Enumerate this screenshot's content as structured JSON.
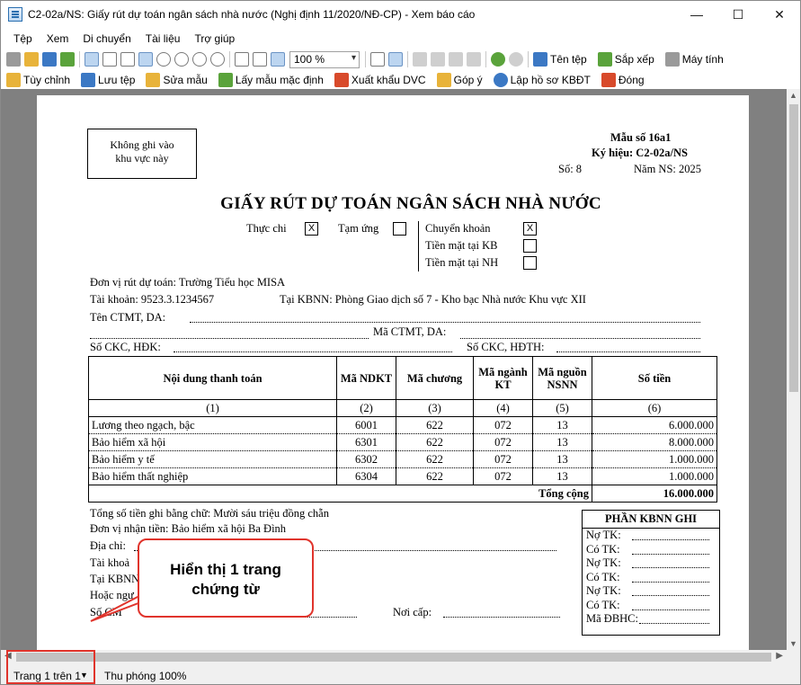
{
  "window": {
    "title": "C2-02a/NS: Giấy rút dự toán ngân sách nhà nước (Nghị định 11/2020/NĐ-CP) - Xem báo cáo",
    "minimize": "—",
    "maximize": "☐",
    "close": "✕"
  },
  "menu": [
    "Tệp",
    "Xem",
    "Di chuyển",
    "Tài liệu",
    "Trợ giúp"
  ],
  "toolbar1": {
    "zoom_value": "100 %",
    "filename_label": "Tên tệp",
    "sort_label": "Sắp xếp",
    "computer_label": "Máy tính"
  },
  "toolbar2": {
    "customize": "Tùy chỉnh",
    "save_template": "Lưu tệp",
    "edit_template": "Sửa mẫu",
    "default_template": "Lấy mẫu mặc định",
    "export_dvc": "Xuất khẩu DVC",
    "feedback": "Góp ý",
    "create_kbdt": "Lập hồ sơ KBĐT",
    "close": "Đóng"
  },
  "document": {
    "no_write_box": [
      "Không ghi vào",
      "khu vực này"
    ],
    "form_no": "Mẫu số 16a1",
    "symbol": "Ký hiệu: C2-02a/NS",
    "number": "Số: 8",
    "budget_year": "Năm NS: 2025",
    "title": "GIẤY RÚT DỰ TOÁN NGÂN SÁCH NHÀ NƯỚC",
    "options": {
      "thuc_chi": "Thực chi",
      "thuc_chi_mark": "X",
      "tam_ung": "Tạm ứng",
      "tam_ung_mark": "",
      "chuyen_khoan": "Chuyển khoản",
      "chuyen_khoan_mark": "X",
      "tien_mat_kb": "Tiền mặt tại KB",
      "tien_mat_kb_mark": "",
      "tien_mat_nh": "Tiền mặt tại NH",
      "tien_mat_nh_mark": ""
    },
    "unit": "Đơn vị rút dự toán: Trường Tiểu học MISA",
    "account": "Tài khoản: 9523.3.1234567",
    "kbnn": "Tại KBNN: Phòng Giao dịch số 7 - Kho bạc Nhà nước Khu vực XII",
    "ten_ctmt": "Tên  CTMT,  DA:",
    "ma_ctmt": "Mã  CTMT,  DA:",
    "so_ckc_hdk": "Số  CKC,  HĐK:",
    "so_ckc_hdth": "Số  CKC,  HĐTH:",
    "table": {
      "headers": [
        "Nội dung thanh toán",
        "Mã NDKT",
        "Mã chương",
        "Mã ngành KT",
        "Mã nguồn NSNN",
        "Số tiền"
      ],
      "col_numbers": [
        "(1)",
        "(2)",
        "(3)",
        "(4)",
        "(5)",
        "(6)"
      ],
      "rows": [
        [
          "Lương theo ngạch, bậc",
          "6001",
          "622",
          "072",
          "13",
          "6.000.000"
        ],
        [
          "Bảo hiểm xã hội",
          "6301",
          "622",
          "072",
          "13",
          "8.000.000"
        ],
        [
          "Bảo hiểm y tế",
          "6302",
          "622",
          "072",
          "13",
          "1.000.000"
        ],
        [
          "Bảo hiểm thất nghiệp",
          "6304",
          "622",
          "072",
          "13",
          "1.000.000"
        ]
      ],
      "total_label": "Tổng cộng",
      "total_value": "16.000.000"
    },
    "amount_words": "Tổng số tiền ghi bằng chữ: Mười sáu triệu đồng chẵn",
    "recipient": "Đơn vị nhận tiền: Bảo hiểm xã hội Ba Đình",
    "address": "Địa  chỉ:",
    "recv_account": "Tài khoả",
    "recv_kbnn": "Tại KBNN",
    "or_recipient": "Hoặc  ngư",
    "id_no": "Số CM",
    "issue_place": "Nơi  cấp:",
    "kbnn_box": {
      "title": "PHẦN KBNN GHI",
      "rows": [
        "Nợ TK:",
        "Có TK:",
        "Nợ TK:",
        "Có TK:",
        "Nợ TK:",
        "Có TK:",
        "Mã ĐBHC:"
      ]
    }
  },
  "callout": {
    "line1": "Hiển thị 1 trang",
    "line2": "chứng từ"
  },
  "status": {
    "page": "Trang 1 trên 1",
    "zoom": "Thu phóng 100%"
  }
}
